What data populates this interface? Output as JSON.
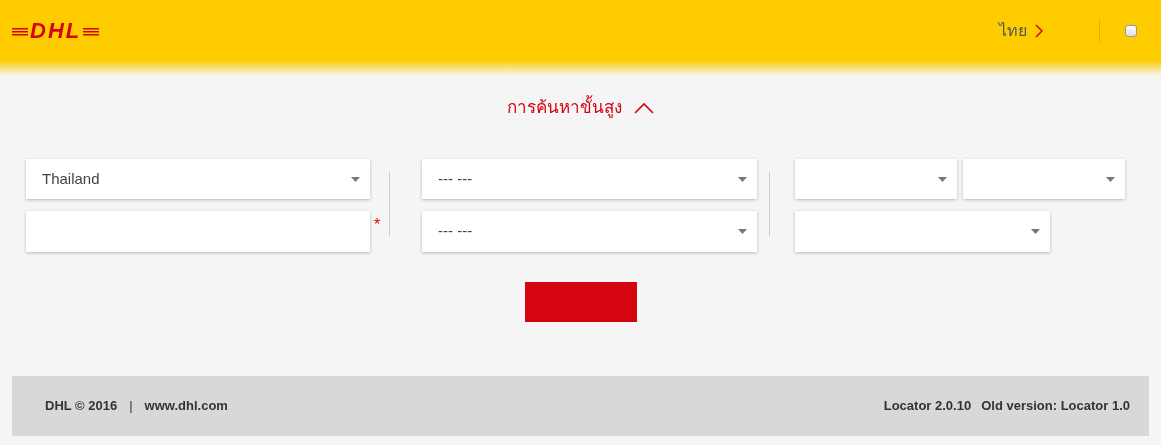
{
  "header": {
    "logo": "DHL",
    "language": "ไทย",
    "checkbox": {
      "checked": false
    }
  },
  "advanced_search": {
    "label": "การค้นหาขั้นสูง",
    "expanded": true
  },
  "form": {
    "columns": [
      {
        "rows": [
          [
            {
              "kind": "select",
              "value": "Thailand"
            }
          ],
          [
            {
              "kind": "input",
              "required_marker": "*"
            }
          ]
        ]
      },
      {
        "rows": [
          [
            {
              "kind": "select",
              "value": "--- ---"
            }
          ],
          [
            {
              "kind": "select",
              "value": "--- ---"
            }
          ]
        ]
      },
      {
        "rows": [
          [
            {
              "kind": "select"
            },
            {
              "kind": "select"
            }
          ],
          [
            {
              "kind": "select"
            }
          ]
        ]
      }
    ]
  },
  "footer": {
    "copyright": "DHL © 2016",
    "separator": "|",
    "link": "www.dhl.com",
    "version": "Locator 2.0.10",
    "old_version": "Old version: Locator 1.0"
  }
}
